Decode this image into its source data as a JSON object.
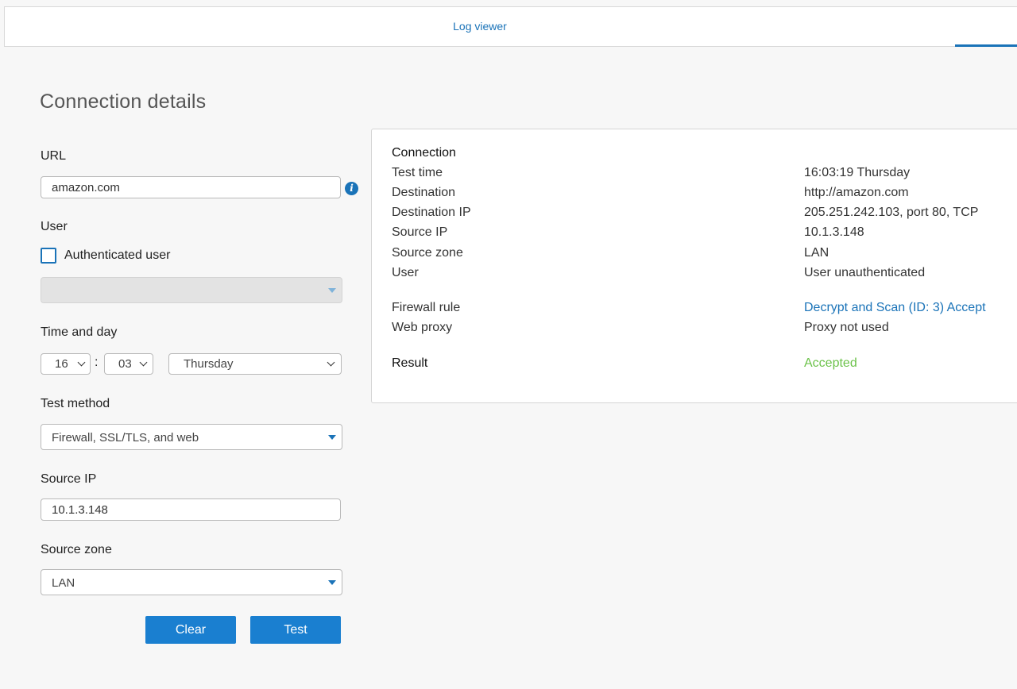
{
  "topbar": {
    "tab_label": "Log viewer"
  },
  "page": {
    "title": "Connection details"
  },
  "form": {
    "url_label": "URL",
    "url_value": "amazon.com",
    "info_icon_glyph": "i",
    "user_label": "User",
    "auth_user_label": "Authenticated user",
    "auth_user_checked": false,
    "time_label": "Time and day",
    "hour": "16",
    "minute": "03",
    "time_separator": ":",
    "day": "Thursday",
    "test_method_label": "Test method",
    "test_method_value": "Firewall, SSL/TLS, and web",
    "source_ip_label": "Source IP",
    "source_ip_value": "10.1.3.148",
    "source_zone_label": "Source zone",
    "source_zone_value": "LAN",
    "clear_label": "Clear",
    "test_label": "Test"
  },
  "result": {
    "section_title": "Connection",
    "rows": [
      {
        "key": "Test time",
        "value": "16:03:19 Thursday"
      },
      {
        "key": "Destination",
        "value": "http://amazon.com"
      },
      {
        "key": "Destination IP",
        "value": "205.251.242.103, port 80, TCP"
      },
      {
        "key": "Source IP",
        "value": "10.1.3.148"
      },
      {
        "key": "Source zone",
        "value": "LAN"
      },
      {
        "key": "User",
        "value": "User unauthenticated"
      },
      {
        "key": "Firewall rule",
        "value": "Decrypt and Scan (ID: 3) Accept"
      },
      {
        "key": "Web proxy",
        "value": "Proxy not used"
      }
    ],
    "result_label": "Result",
    "result_value": "Accepted"
  },
  "colors": {
    "accent": "#1a73b8",
    "button": "#1a7fd0",
    "accepted": "#6cc24a",
    "background": "#f7f7f7"
  }
}
